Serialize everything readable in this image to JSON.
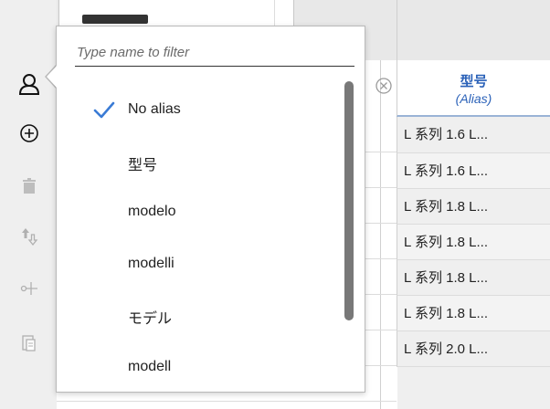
{
  "alias_dropdown": {
    "filter_placeholder": "Type name to filter",
    "options": [
      {
        "label": "No alias",
        "selected": true
      },
      {
        "label": "型号",
        "selected": false
      },
      {
        "label": "modelo",
        "selected": false
      },
      {
        "label": "modelli",
        "selected": false
      },
      {
        "label": "モデル",
        "selected": false
      },
      {
        "label": "modell",
        "selected": false
      }
    ]
  },
  "column_header": {
    "title": "型号",
    "subtitle": "(Alias)"
  },
  "rows": [
    "L 系列 1.6 L...",
    "L 系列 1.6 L...",
    "L 系列 1.8 L...",
    "L 系列 1.8 L...",
    "L 系列 1.8 L...",
    "L 系列 1.8 L...",
    "L 系列 2.0 L..."
  ],
  "toolbar": {
    "icons": [
      "person-icon",
      "add-circle-icon",
      "trash-icon",
      "swap-icon",
      "cut-icon",
      "paste-icon"
    ]
  },
  "colors": {
    "accent": "#2a61b8",
    "check": "#3a7bd5"
  }
}
